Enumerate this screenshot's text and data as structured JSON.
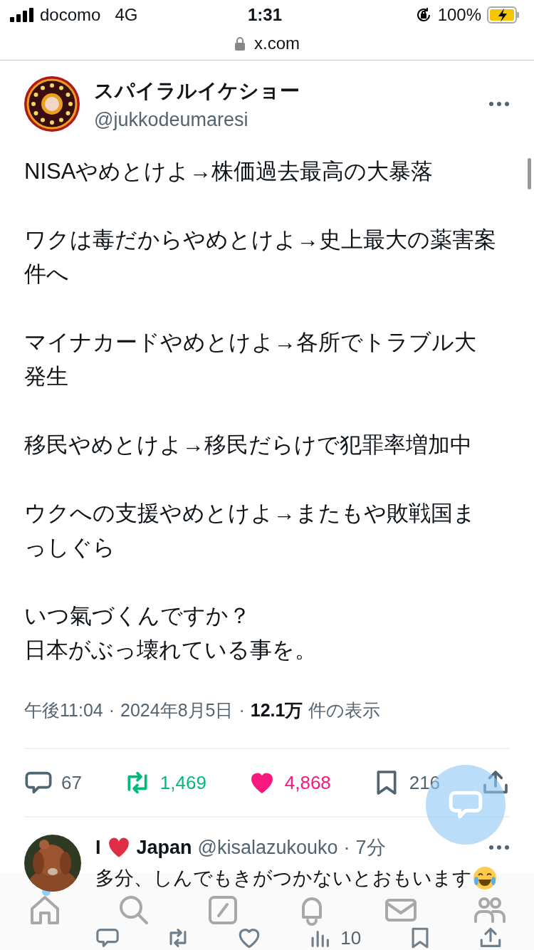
{
  "status_bar": {
    "carrier": "docomo",
    "network": "4G",
    "time": "1:31",
    "battery": "100%"
  },
  "url_bar": {
    "url": "x.com"
  },
  "tweet": {
    "name": "スパイラルイケショー",
    "handle": "@jukkodeumaresi",
    "paragraphs": [
      [
        "NISAやめとけよ→株価過去最高の大暴落"
      ],
      [
        "ワクは毒だからやめとけよ→史上最大の薬害案件へ"
      ],
      [
        "マイナカードやめとけよ→各所でトラブル大発生"
      ],
      [
        "移民やめとけよ→移民だらけで犯罪率増加中"
      ],
      [
        "ウクへの支援やめとけよ→またもや敗戦国まっしぐら"
      ],
      [
        "いつ氣づくんですか？",
        "日本がぶっ壊れている事を。"
      ]
    ],
    "time": "午後11:04",
    "separator_1": "·",
    "date": "2024年8月5日",
    "separator_2": "·",
    "views_count": "12.1万",
    "views_label": "件の表示",
    "actions": [
      {
        "kind": "reply",
        "count": "67",
        "active": false
      },
      {
        "kind": "retweet",
        "count": "1,469",
        "active": true
      },
      {
        "kind": "like",
        "count": "4,868",
        "active": true
      },
      {
        "kind": "bookmark",
        "count": "216",
        "active": false
      },
      {
        "kind": "share",
        "active": false
      }
    ]
  },
  "reply": {
    "name_start": "I",
    "name_end": "Japan",
    "handle": "@kisalazukouko",
    "separator": "·",
    "age": "7分",
    "text": "多分、しんでもきがつかないとおもいます",
    "actions": [
      {
        "kind": "reply"
      },
      {
        "kind": "retweet"
      },
      {
        "kind": "like"
      },
      {
        "kind": "views",
        "count": "10"
      },
      {
        "kind": "bookmark"
      },
      {
        "kind": "share"
      }
    ]
  },
  "tab_bar": [
    {
      "kind": "home",
      "selected": false,
      "unread": true
    },
    {
      "kind": "search",
      "selected": false,
      "unread": false
    },
    {
      "kind": "compose",
      "selected": false,
      "unread": false
    },
    {
      "kind": "notifications",
      "selected": false,
      "unread": false
    },
    {
      "kind": "messages",
      "selected": false,
      "unread": false
    },
    {
      "kind": "communities",
      "selected": false,
      "unread": false
    }
  ]
}
